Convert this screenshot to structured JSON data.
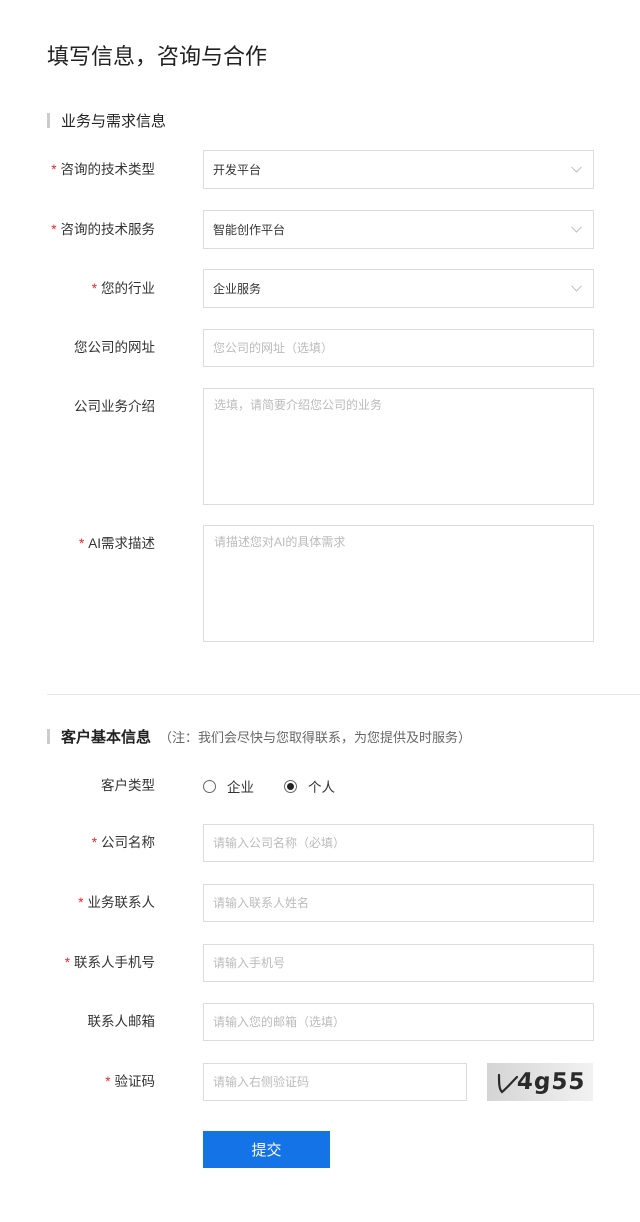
{
  "page_title": "填写信息，咨询与合作",
  "required_mark": "*",
  "business_section": {
    "heading": "业务与需求信息",
    "tech_type": {
      "label": "咨询的技术类型",
      "value": "开发平台"
    },
    "tech_service": {
      "label": "咨询的技术服务",
      "value": "智能创作平台"
    },
    "industry": {
      "label": "您的行业",
      "value": "企业服务"
    },
    "website": {
      "label": "您公司的网址",
      "placeholder": "您公司的网址（选填）"
    },
    "intro": {
      "label": "公司业务介绍",
      "placeholder": "选填，请简要介绍您公司的业务"
    },
    "ai_need": {
      "label": "AI需求描述",
      "placeholder": "请描述您对AI的具体需求"
    }
  },
  "customer_section": {
    "heading": "客户基本信息",
    "note": "（注：我们会尽快与您取得联系，为您提供及时服务）",
    "customer_type": {
      "label": "客户类型",
      "options": [
        {
          "label": "企业",
          "selected": false
        },
        {
          "label": "个人",
          "selected": true
        }
      ]
    },
    "company_name": {
      "label": "公司名称",
      "placeholder": "请输入公司名称（必填）"
    },
    "contact": {
      "label": "业务联系人",
      "placeholder": "请输入联系人姓名"
    },
    "phone": {
      "label": "联系人手机号",
      "placeholder": "请输入手机号"
    },
    "email": {
      "label": "联系人邮箱",
      "placeholder": "请输入您的邮箱（选填）"
    },
    "captcha": {
      "label": "验证码",
      "placeholder": "请输入右侧验证码",
      "image_text": "4g55"
    }
  },
  "submit_label": "提交",
  "colors": {
    "accent": "#1473e6",
    "required": "#f5222d",
    "border": "#dcdcdc",
    "placeholder": "#bbbbbb"
  },
  "icons": {
    "select_arrow": "chevron-down-icon",
    "radio": "radio-icon"
  }
}
